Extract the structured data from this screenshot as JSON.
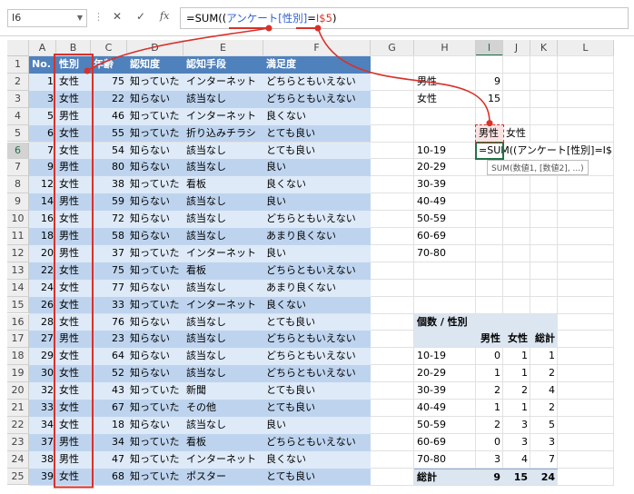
{
  "formula_bar": {
    "name_box": "I6",
    "fx_label": "fx",
    "formula_prefix": "=SUM((",
    "formula_blue": "アンケート[性別]",
    "formula_mid": "=",
    "formula_red": "I$5",
    "formula_suffix": ")"
  },
  "columns": [
    "A",
    "B",
    "C",
    "D",
    "E",
    "F",
    "G",
    "H",
    "I",
    "J",
    "K",
    "L"
  ],
  "rows": [
    "1",
    "2",
    "3",
    "4",
    "5",
    "6",
    "7",
    "8",
    "9",
    "10",
    "11",
    "12",
    "13",
    "14",
    "15",
    "16",
    "17",
    "18",
    "19",
    "20",
    "21",
    "22",
    "23",
    "24",
    "25"
  ],
  "table": {
    "headers": [
      "No.",
      "性別",
      "年齢",
      "認知度",
      "認知手段",
      "満足度"
    ],
    "records": [
      [
        "1",
        "女性",
        "75",
        "知っていた",
        "インターネット",
        "どちらともいえない"
      ],
      [
        "3",
        "女性",
        "22",
        "知らない",
        "該当なし",
        "どちらともいえない"
      ],
      [
        "5",
        "男性",
        "46",
        "知っていた",
        "インターネット",
        "良くない"
      ],
      [
        "6",
        "女性",
        "55",
        "知っていた",
        "折り込みチラシ",
        "とても良い"
      ],
      [
        "7",
        "女性",
        "54",
        "知らない",
        "該当なし",
        "とても良い"
      ],
      [
        "9",
        "男性",
        "80",
        "知らない",
        "該当なし",
        "良い"
      ],
      [
        "12",
        "女性",
        "38",
        "知っていた",
        "看板",
        "良くない"
      ],
      [
        "14",
        "男性",
        "59",
        "知らない",
        "該当なし",
        "良い"
      ],
      [
        "16",
        "女性",
        "72",
        "知らない",
        "該当なし",
        "どちらともいえない"
      ],
      [
        "18",
        "男性",
        "58",
        "知らない",
        "該当なし",
        "あまり良くない"
      ],
      [
        "20",
        "男性",
        "37",
        "知っていた",
        "インターネット",
        "良い"
      ],
      [
        "22",
        "女性",
        "75",
        "知っていた",
        "看板",
        "どちらともいえない"
      ],
      [
        "24",
        "女性",
        "77",
        "知らない",
        "該当なし",
        "あまり良くない"
      ],
      [
        "26",
        "女性",
        "33",
        "知っていた",
        "インターネット",
        "良くない"
      ],
      [
        "28",
        "女性",
        "76",
        "知らない",
        "該当なし",
        "とても良い"
      ],
      [
        "27",
        "男性",
        "23",
        "知らない",
        "該当なし",
        "どちらともいえない"
      ],
      [
        "29",
        "女性",
        "64",
        "知らない",
        "該当なし",
        "どちらともいえない"
      ],
      [
        "30",
        "女性",
        "52",
        "知らない",
        "該当なし",
        "どちらともいえない"
      ],
      [
        "32",
        "女性",
        "43",
        "知っていた",
        "新聞",
        "とても良い"
      ],
      [
        "33",
        "女性",
        "67",
        "知っていた",
        "その他",
        "とても良い"
      ],
      [
        "34",
        "女性",
        "18",
        "知らない",
        "該当なし",
        "良い"
      ],
      [
        "37",
        "男性",
        "34",
        "知っていた",
        "看板",
        "どちらともいえない"
      ],
      [
        "38",
        "男性",
        "47",
        "知っていた",
        "インターネット",
        "良くない"
      ],
      [
        "39",
        "女性",
        "68",
        "知っていた",
        "ポスター",
        "とても良い"
      ]
    ]
  },
  "gender_counts": [
    {
      "label": "男性",
      "value": "9"
    },
    {
      "label": "女性",
      "value": "15"
    }
  ],
  "summary": {
    "header_male": "男性",
    "header_female": "女性",
    "ranges": [
      "10-19",
      "20-29",
      "30-39",
      "40-49",
      "50-59",
      "60-69",
      "70-80"
    ],
    "active_formula": "=SUM((アンケート[性別]=I$5",
    "tooltip": "SUM(数値1, [数値2], ...)"
  },
  "pivot": {
    "title": "個数 / 性別",
    "col_headers": [
      "男性",
      "女性",
      "総計"
    ],
    "rows": [
      {
        "label": "10-19",
        "values": [
          "0",
          "1",
          "1"
        ]
      },
      {
        "label": "20-29",
        "values": [
          "1",
          "1",
          "2"
        ]
      },
      {
        "label": "30-39",
        "values": [
          "2",
          "2",
          "4"
        ]
      },
      {
        "label": "40-49",
        "values": [
          "1",
          "1",
          "2"
        ]
      },
      {
        "label": "50-59",
        "values": [
          "2",
          "3",
          "5"
        ]
      },
      {
        "label": "60-69",
        "values": [
          "0",
          "3",
          "3"
        ]
      },
      {
        "label": "70-80",
        "values": [
          "3",
          "4",
          "7"
        ]
      }
    ],
    "total": {
      "label": "総計",
      "values": [
        "9",
        "15",
        "24"
      ]
    }
  },
  "colors": {
    "header_blue": "#4f81bd",
    "band_dark": "#bed4ee",
    "band_light": "#deeaf8",
    "annotation_red": "#d8312a",
    "formula_blue": "#2f5fd0",
    "excel_green": "#217346"
  }
}
